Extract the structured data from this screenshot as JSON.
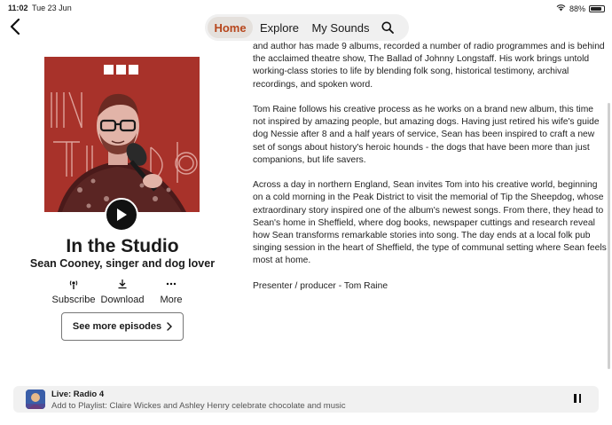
{
  "status_bar": {
    "time": "11:02",
    "date": "Tue 23 Jun",
    "battery": "88%",
    "battery_level": 0.88
  },
  "nav": {
    "tabs": [
      {
        "label": "Home",
        "active": true
      },
      {
        "label": "Explore"
      },
      {
        "label": "My Sounds"
      }
    ],
    "icons": [
      "back-chevron-icon",
      "search-icon"
    ]
  },
  "artwork": {
    "brand": [
      "B",
      "B",
      "C"
    ],
    "background_color": "#a8322a"
  },
  "show": {
    "title": "In the Studio",
    "subtitle": "Sean Cooney, singer and dog lover"
  },
  "actions": {
    "subscribe": "Subscribe",
    "download": "Download",
    "more": "More"
  },
  "more_episodes": {
    "label": "See more episodes"
  },
  "description": {
    "paragraphs": [
      "and author has made 9 albums, recorded a number of radio programmes and is behind the acclaimed theatre show, The Ballad of Johnny Longstaff. His work brings untold working-class stories to life by blending folk song, historical testimony, archival recordings, and spoken word.",
      "Tom Raine follows his creative process as he works on a brand new album, this time not inspired by amazing people, but amazing dogs. Having just retired his wife's guide dog Nessie after 8 and a half years of service, Sean has been inspired to craft a new set of songs about history's heroic hounds - the dogs that have been more than just companions, but life savers.",
      "Across a day in northern England, Sean invites Tom into his creative world, beginning on a cold morning in the Peak District to visit the memorial of Tip the Sheepdog, whose extraordinary story inspired one of the album's newest songs. From there, they head to Sean's home in Sheffield, where dog books, newspaper cuttings and research reveal how Sean transforms remarkable stories into song. The day ends at a local folk pub singing session in the heart of Sheffield, the type of communal setting where Sean feels most at home.",
      "Presenter / producer - Tom Raine"
    ]
  },
  "mini_player": {
    "title": "Live: Radio 4",
    "subtitle": "Add to Playlist: Claire Wickes and Ashley Henry celebrate chocolate and music"
  },
  "colors": {
    "accent": "#b7461c",
    "active_tab_bg": "#e4e0dc",
    "nav_bg": "#f0f0f0",
    "player_bg": "#f1f1f1"
  }
}
